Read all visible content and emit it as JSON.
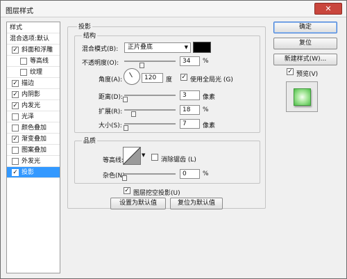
{
  "window": {
    "title": "图层样式",
    "close_glyph": "✕"
  },
  "sidebar": {
    "header": "样式",
    "blend_default": "混合选项:默认",
    "items": [
      {
        "label": "斜面和浮雕",
        "checked": true
      },
      {
        "label": "等高线",
        "checked": false
      },
      {
        "label": "纹理",
        "checked": false
      },
      {
        "label": "描边",
        "checked": true
      },
      {
        "label": "内阴影",
        "checked": true
      },
      {
        "label": "内发光",
        "checked": true
      },
      {
        "label": "光泽",
        "checked": false
      },
      {
        "label": "颜色叠加",
        "checked": false
      },
      {
        "label": "渐变叠加",
        "checked": true
      },
      {
        "label": "图案叠加",
        "checked": false
      },
      {
        "label": "外发光",
        "checked": false
      },
      {
        "label": "投影",
        "checked": true
      }
    ]
  },
  "drop_shadow": {
    "section_title": "投影",
    "structure": {
      "title": "结构",
      "blend_mode_label": "混合模式(B):",
      "blend_mode_value": "正片叠底",
      "color": "#000000",
      "opacity_label": "不透明度(O):",
      "opacity_value": "34",
      "opacity_fraction": 0.34,
      "opacity_unit": "%",
      "angle_label": "角度(A):",
      "angle_value": "120",
      "angle_unit": "度",
      "global_light_label": "使用全局光 (G)",
      "global_light_checked": true,
      "distance_label": "距离(D):",
      "distance_value": "3",
      "distance_unit": "像素",
      "distance_fraction": 0.02,
      "spread_label": "扩展(R):",
      "spread_value": "18",
      "spread_unit": "%",
      "spread_fraction": 0.18,
      "size_label": "大小(S):",
      "size_value": "7",
      "size_unit": "像素",
      "size_fraction": 0.03
    },
    "quality": {
      "title": "品质",
      "contour_label": "等高线:",
      "anti_alias_label": "消除锯齿 (L)",
      "anti_alias_checked": false,
      "noise_label": "杂色(N):",
      "noise_value": "0",
      "noise_unit": "%",
      "noise_fraction": 0.0
    },
    "knockout_label": "图层挖空投影(U)",
    "knockout_checked": true,
    "make_default_label": "设置为默认值",
    "reset_default_label": "复位为默认值"
  },
  "actions": {
    "ok": "确定",
    "reset": "复位",
    "new_style": "新建样式(W)...",
    "preview_label": "预览(V)",
    "preview_checked": true
  }
}
